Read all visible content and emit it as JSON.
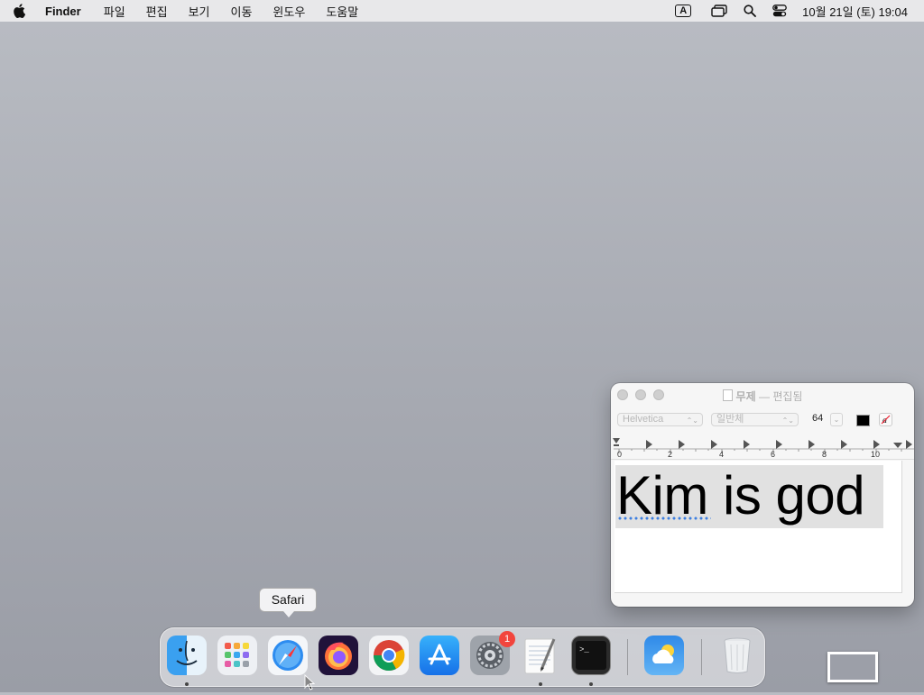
{
  "menubar": {
    "app_name": "Finder",
    "menus": [
      "파일",
      "편집",
      "보기",
      "이동",
      "윈도우",
      "도움말"
    ],
    "input_source": "A",
    "clock": "10월 21일 (토) 19:04"
  },
  "textedit": {
    "title_name": "무제",
    "title_suffix": "— 편집됨",
    "font_family": "Helvetica",
    "font_style": "일반체",
    "font_size": "64",
    "ruler_labels": [
      "0",
      "2",
      "4",
      "6",
      "8",
      "10"
    ],
    "document_text": "Kim is god"
  },
  "dock": {
    "tooltip": "Safari",
    "apps": [
      "Finder",
      "Launchpad",
      "Safari",
      "Firefox",
      "Chrome",
      "App Store",
      "System Settings",
      "TextEdit",
      "Terminal",
      "Weather",
      "Trash"
    ],
    "settings_badge": "1"
  }
}
